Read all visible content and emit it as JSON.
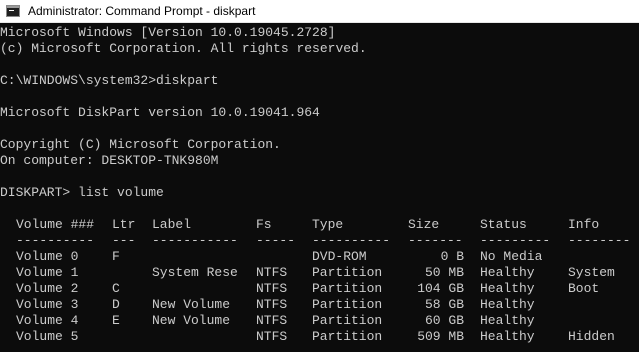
{
  "window": {
    "title": "Administrator: Command Prompt - diskpart",
    "icon": "cmd-icon"
  },
  "console": {
    "banner_line1": "Microsoft Windows [Version 10.0.19045.2728]",
    "banner_line2": "(c) Microsoft Corporation. All rights reserved.",
    "command_line": "C:\\WINDOWS\\system32>diskpart",
    "diskpart_version": "Microsoft DiskPart version 10.0.19041.964",
    "copyright": "Copyright (C) Microsoft Corporation.",
    "computer": "On computer: DESKTOP-TNK980M",
    "diskpart_command": "DISKPART> list volume"
  },
  "volumes": {
    "headers": [
      "Volume ###",
      "Ltr",
      "Label",
      "Fs",
      "Type",
      "Size",
      "Status",
      "Info"
    ],
    "separators": [
      "----------",
      "---",
      "-----------",
      "-----",
      "----------",
      "-------",
      "---------",
      "--------"
    ],
    "rows": [
      [
        "Volume 0",
        "F",
        "",
        "",
        "DVD-ROM",
        "0 B",
        "No Media",
        ""
      ],
      [
        "Volume 1",
        "",
        "System Rese",
        "NTFS",
        "Partition",
        "50 MB",
        "Healthy",
        "System"
      ],
      [
        "Volume 2",
        "C",
        "",
        "NTFS",
        "Partition",
        "104 GB",
        "Healthy",
        "Boot"
      ],
      [
        "Volume 3",
        "D",
        "New Volume",
        "NTFS",
        "Partition",
        "58 GB",
        "Healthy",
        ""
      ],
      [
        "Volume 4",
        "E",
        "New Volume",
        "NTFS",
        "Partition",
        "60 GB",
        "Healthy",
        ""
      ],
      [
        "Volume 5",
        "",
        "",
        "NTFS",
        "Partition",
        "509 MB",
        "Healthy",
        "Hidden"
      ]
    ]
  },
  "colors": {
    "console_background": "#0c0c0c",
    "console_text": "#cccccc",
    "titlebar_background": "#ffffff"
  }
}
